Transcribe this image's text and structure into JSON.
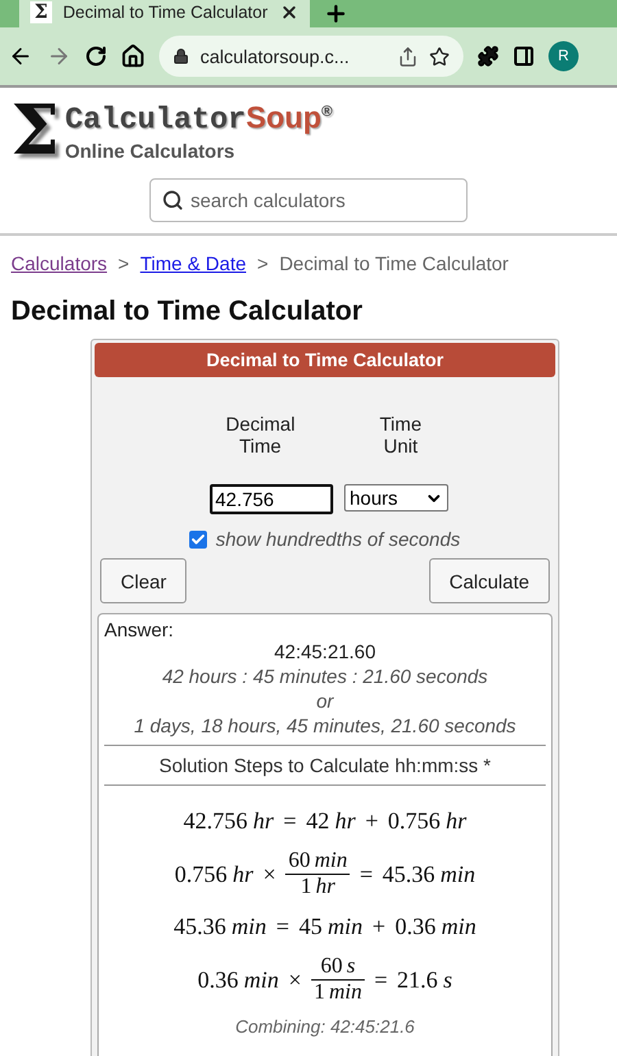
{
  "browser": {
    "favicon": "Σ",
    "tab_title": "Decimal to Time Calculator",
    "url": "calculatorsoup.c...",
    "profile": "R"
  },
  "logo": {
    "sigma": "Σ",
    "brand_first": "Calculator",
    "brand_second": "Soup",
    "mark": "®",
    "tagline": "Online Calculators"
  },
  "search": {
    "placeholder": "search calculators"
  },
  "breadcrumbs": [
    {
      "kind": "link",
      "label": "Calculators",
      "visited": true
    },
    {
      "kind": "sep",
      "label": ">"
    },
    {
      "kind": "link",
      "label": "Time & Date",
      "visited": false
    },
    {
      "kind": "sep",
      "label": ">"
    },
    {
      "kind": "current",
      "label": "Decimal to Time Calculator"
    }
  ],
  "page_title": "Decimal to Time Calculator",
  "calculator": {
    "header": "Decimal to Time Calculator",
    "labels": [
      "Decimal Time",
      "Time Unit"
    ],
    "value": "42.756",
    "unit": "hours",
    "checkbox": {
      "label": "show hundredths of seconds",
      "checked": true
    },
    "buttons": [
      "Clear",
      "Calculate"
    ]
  },
  "answer": {
    "label": "Answer:",
    "result": "42:45:21.60",
    "details": [
      "42 hours : 45 minutes : 21.60 seconds",
      "or",
      "1 days, 18 hours, 45 minutes, 21.60 seconds"
    ],
    "steps_title": "Solution Steps to Calculate hh:mm:ss *",
    "equations": [
      [
        {
          "kind": "num",
          "text": "42.756"
        },
        {
          "kind": "unit",
          "text": "hr"
        },
        {
          "kind": "op",
          "text": "="
        },
        {
          "kind": "num",
          "text": "42"
        },
        {
          "kind": "unit",
          "text": "hr"
        },
        {
          "kind": "op",
          "text": "+"
        },
        {
          "kind": "num",
          "text": "0.756"
        },
        {
          "kind": "unit",
          "text": "hr"
        }
      ],
      [
        {
          "kind": "num",
          "text": "0.756"
        },
        {
          "kind": "unit",
          "text": "hr"
        },
        {
          "kind": "op",
          "text": "×"
        },
        {
          "kind": "frac",
          "num": [
            {
              "kind": "num",
              "text": "60"
            },
            {
              "kind": "unit",
              "text": "min"
            }
          ],
          "den": [
            {
              "kind": "num",
              "text": "1"
            },
            {
              "kind": "unit",
              "text": "hr"
            }
          ]
        },
        {
          "kind": "op",
          "text": "="
        },
        {
          "kind": "num",
          "text": "45.36"
        },
        {
          "kind": "unit",
          "text": "min"
        }
      ],
      [
        {
          "kind": "num",
          "text": "45.36"
        },
        {
          "kind": "unit",
          "text": "min"
        },
        {
          "kind": "op",
          "text": "="
        },
        {
          "kind": "num",
          "text": "45"
        },
        {
          "kind": "unit",
          "text": "min"
        },
        {
          "kind": "op",
          "text": "+"
        },
        {
          "kind": "num",
          "text": "0.36"
        },
        {
          "kind": "unit",
          "text": "min"
        }
      ],
      [
        {
          "kind": "num",
          "text": "0.36"
        },
        {
          "kind": "unit",
          "text": "min"
        },
        {
          "kind": "op",
          "text": "×"
        },
        {
          "kind": "frac",
          "num": [
            {
              "kind": "num",
              "text": "60"
            },
            {
              "kind": "unit",
              "text": "s"
            }
          ],
          "den": [
            {
              "kind": "num",
              "text": "1"
            },
            {
              "kind": "unit",
              "text": "min"
            }
          ]
        },
        {
          "kind": "op",
          "text": "="
        },
        {
          "kind": "num",
          "text": "21.6"
        },
        {
          "kind": "unit",
          "text": "s"
        }
      ]
    ],
    "combining": "Combining: 42:45:21.6"
  }
}
